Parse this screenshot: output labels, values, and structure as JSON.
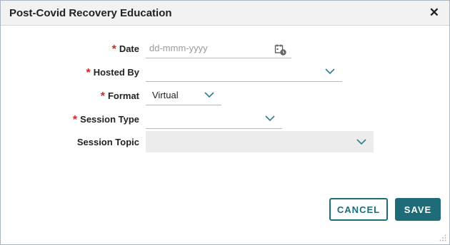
{
  "dialog": {
    "title": "Post-Covid Recovery Education",
    "close_icon": "close-icon"
  },
  "form": {
    "date": {
      "label": "Date",
      "required": true,
      "placeholder": "dd-mmm-yyyy",
      "value": "",
      "icon": "calendar-icon"
    },
    "hosted_by": {
      "label": "Hosted By",
      "required": true,
      "value": "",
      "icon": "chevron-down-icon"
    },
    "format": {
      "label": "Format",
      "required": true,
      "value": "Virtual",
      "icon": "chevron-down-icon"
    },
    "session_type": {
      "label": "Session Type",
      "required": true,
      "value": "",
      "icon": "chevron-down-icon"
    },
    "session_topic": {
      "label": "Session Topic",
      "required": false,
      "value": "",
      "icon": "chevron-down-icon",
      "disabled": true
    }
  },
  "buttons": {
    "cancel_label": "CANCEL",
    "save_label": "SAVE"
  },
  "colors": {
    "accent": "#1d6c78",
    "required": "#d42525",
    "chevron": "#2e7d8c"
  }
}
